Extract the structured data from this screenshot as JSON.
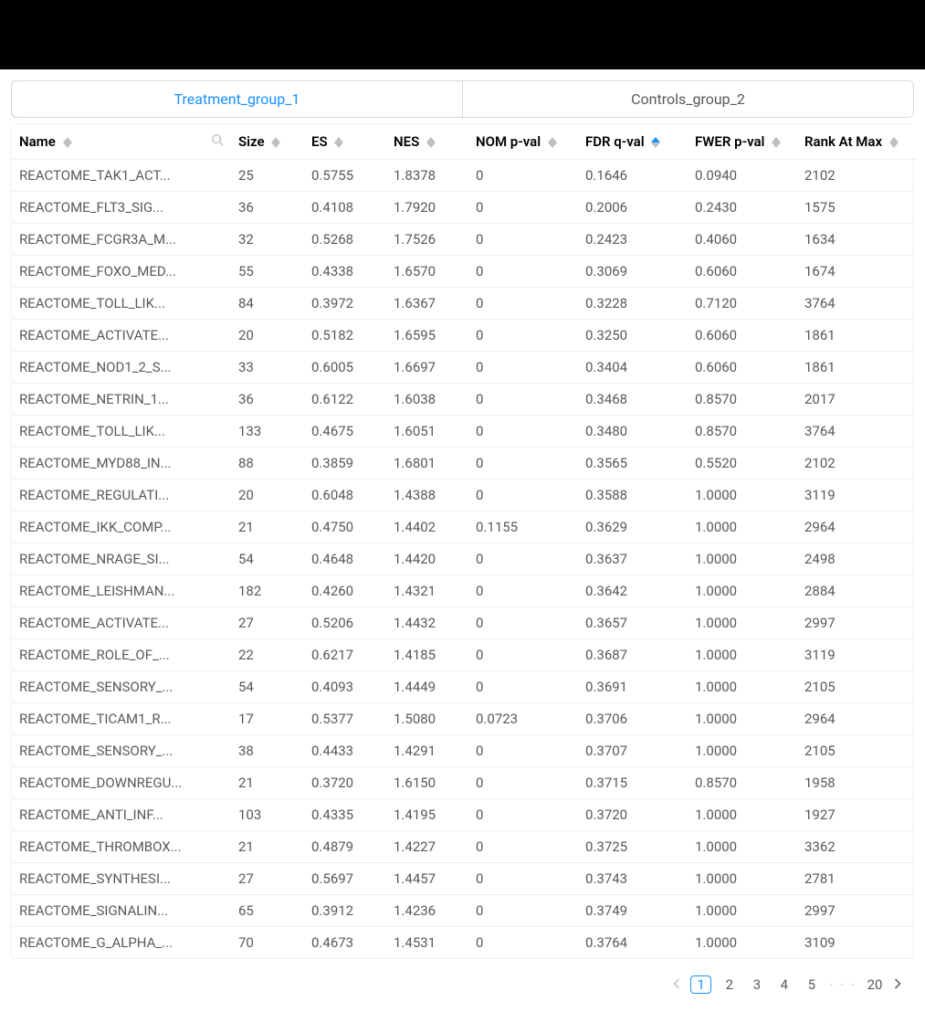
{
  "tabs": {
    "active": "Treatment_group_1",
    "inactive": "Controls_group_2"
  },
  "columns": {
    "name": "Name",
    "size": "Size",
    "es": "ES",
    "nes": "NES",
    "nom": "NOM p-val",
    "fdr": "FDR q-val",
    "fwer": "FWER p-val",
    "rank": "Rank At Max"
  },
  "rows": [
    {
      "name": "REACTOME_TAK1_ACT...",
      "size": "25",
      "es": "0.5755",
      "nes": "1.8378",
      "nom": "0",
      "fdr": "0.1646",
      "fwer": "0.0940",
      "rank": "2102"
    },
    {
      "name": "REACTOME_FLT3_SIG...",
      "size": "36",
      "es": "0.4108",
      "nes": "1.7920",
      "nom": "0",
      "fdr": "0.2006",
      "fwer": "0.2430",
      "rank": "1575"
    },
    {
      "name": "REACTOME_FCGR3A_M...",
      "size": "32",
      "es": "0.5268",
      "nes": "1.7526",
      "nom": "0",
      "fdr": "0.2423",
      "fwer": "0.4060",
      "rank": "1634"
    },
    {
      "name": "REACTOME_FOXO_MED...",
      "size": "55",
      "es": "0.4338",
      "nes": "1.6570",
      "nom": "0",
      "fdr": "0.3069",
      "fwer": "0.6060",
      "rank": "1674"
    },
    {
      "name": "REACTOME_TOLL_LIK...",
      "size": "84",
      "es": "0.3972",
      "nes": "1.6367",
      "nom": "0",
      "fdr": "0.3228",
      "fwer": "0.7120",
      "rank": "3764"
    },
    {
      "name": "REACTOME_ACTIVATE...",
      "size": "20",
      "es": "0.5182",
      "nes": "1.6595",
      "nom": "0",
      "fdr": "0.3250",
      "fwer": "0.6060",
      "rank": "1861"
    },
    {
      "name": "REACTOME_NOD1_2_S...",
      "size": "33",
      "es": "0.6005",
      "nes": "1.6697",
      "nom": "0",
      "fdr": "0.3404",
      "fwer": "0.6060",
      "rank": "1861"
    },
    {
      "name": "REACTOME_NETRIN_1...",
      "size": "36",
      "es": "0.6122",
      "nes": "1.6038",
      "nom": "0",
      "fdr": "0.3468",
      "fwer": "0.8570",
      "rank": "2017"
    },
    {
      "name": "REACTOME_TOLL_LIK...",
      "size": "133",
      "es": "0.4675",
      "nes": "1.6051",
      "nom": "0",
      "fdr": "0.3480",
      "fwer": "0.8570",
      "rank": "3764"
    },
    {
      "name": "REACTOME_MYD88_IN...",
      "size": "88",
      "es": "0.3859",
      "nes": "1.6801",
      "nom": "0",
      "fdr": "0.3565",
      "fwer": "0.5520",
      "rank": "2102"
    },
    {
      "name": "REACTOME_REGULATI...",
      "size": "20",
      "es": "0.6048",
      "nes": "1.4388",
      "nom": "0",
      "fdr": "0.3588",
      "fwer": "1.0000",
      "rank": "3119"
    },
    {
      "name": "REACTOME_IKK_COMP...",
      "size": "21",
      "es": "0.4750",
      "nes": "1.4402",
      "nom": "0.1155",
      "fdr": "0.3629",
      "fwer": "1.0000",
      "rank": "2964"
    },
    {
      "name": "REACTOME_NRAGE_SI...",
      "size": "54",
      "es": "0.4648",
      "nes": "1.4420",
      "nom": "0",
      "fdr": "0.3637",
      "fwer": "1.0000",
      "rank": "2498"
    },
    {
      "name": "REACTOME_LEISHMAN...",
      "size": "182",
      "es": "0.4260",
      "nes": "1.4321",
      "nom": "0",
      "fdr": "0.3642",
      "fwer": "1.0000",
      "rank": "2884"
    },
    {
      "name": "REACTOME_ACTIVATE...",
      "size": "27",
      "es": "0.5206",
      "nes": "1.4432",
      "nom": "0",
      "fdr": "0.3657",
      "fwer": "1.0000",
      "rank": "2997"
    },
    {
      "name": "REACTOME_ROLE_OF_...",
      "size": "22",
      "es": "0.6217",
      "nes": "1.4185",
      "nom": "0",
      "fdr": "0.3687",
      "fwer": "1.0000",
      "rank": "3119"
    },
    {
      "name": "REACTOME_SENSORY_...",
      "size": "54",
      "es": "0.4093",
      "nes": "1.4449",
      "nom": "0",
      "fdr": "0.3691",
      "fwer": "1.0000",
      "rank": "2105"
    },
    {
      "name": "REACTOME_TICAM1_R...",
      "size": "17",
      "es": "0.5377",
      "nes": "1.5080",
      "nom": "0.0723",
      "fdr": "0.3706",
      "fwer": "1.0000",
      "rank": "2964"
    },
    {
      "name": "REACTOME_SENSORY_...",
      "size": "38",
      "es": "0.4433",
      "nes": "1.4291",
      "nom": "0",
      "fdr": "0.3707",
      "fwer": "1.0000",
      "rank": "2105"
    },
    {
      "name": "REACTOME_DOWNREGU...",
      "size": "21",
      "es": "0.3720",
      "nes": "1.6150",
      "nom": "0",
      "fdr": "0.3715",
      "fwer": "0.8570",
      "rank": "1958"
    },
    {
      "name": "REACTOME_ANTI_INF...",
      "size": "103",
      "es": "0.4335",
      "nes": "1.4195",
      "nom": "0",
      "fdr": "0.3720",
      "fwer": "1.0000",
      "rank": "1927"
    },
    {
      "name": "REACTOME_THROMBOX...",
      "size": "21",
      "es": "0.4879",
      "nes": "1.4227",
      "nom": "0",
      "fdr": "0.3725",
      "fwer": "1.0000",
      "rank": "3362"
    },
    {
      "name": "REACTOME_SYNTHESI...",
      "size": "27",
      "es": "0.5697",
      "nes": "1.4457",
      "nom": "0",
      "fdr": "0.3743",
      "fwer": "1.0000",
      "rank": "2781"
    },
    {
      "name": "REACTOME_SIGNALIN...",
      "size": "65",
      "es": "0.3912",
      "nes": "1.4236",
      "nom": "0",
      "fdr": "0.3749",
      "fwer": "1.0000",
      "rank": "2997"
    },
    {
      "name": "REACTOME_G_ALPHA_...",
      "size": "70",
      "es": "0.4673",
      "nes": "1.4531",
      "nom": "0",
      "fdr": "0.3764",
      "fwer": "1.0000",
      "rank": "3109"
    }
  ],
  "pagination": {
    "pages": [
      "1",
      "2",
      "3",
      "4",
      "5"
    ],
    "last": "20",
    "ellipsis": "· · ·",
    "active": "1"
  }
}
